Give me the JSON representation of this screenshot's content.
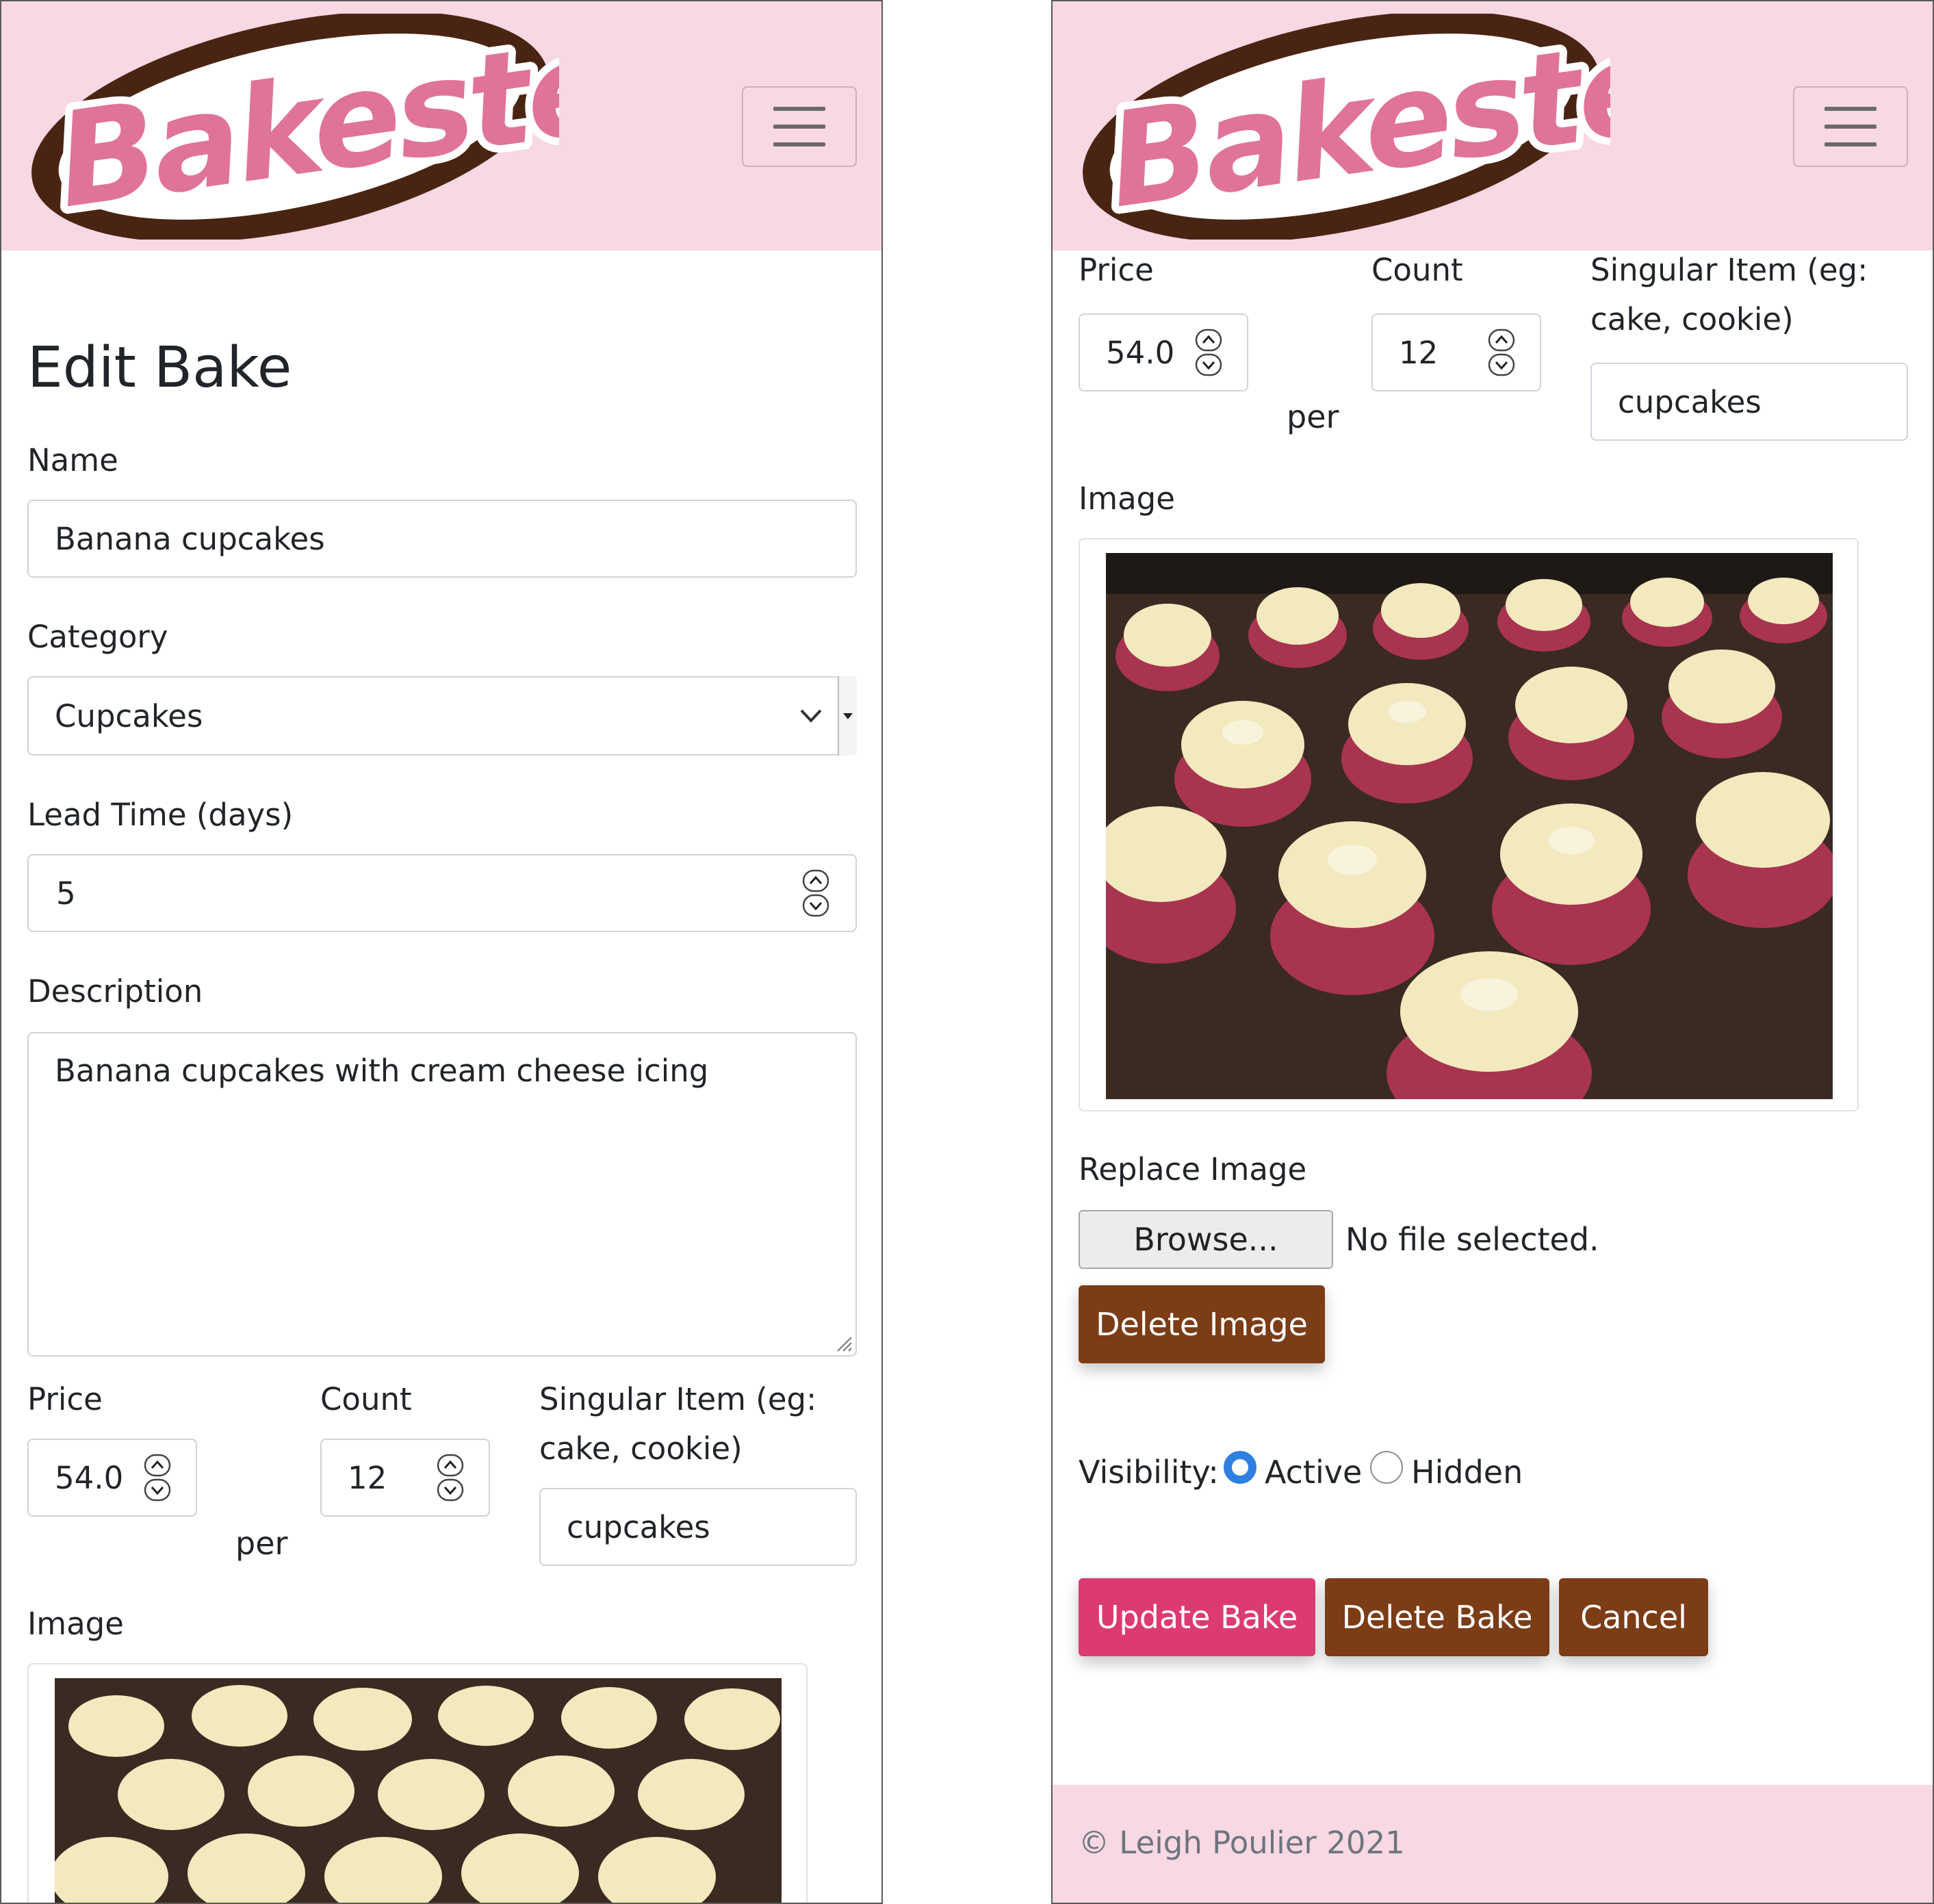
{
  "brand": {
    "logo_text": "Bakester",
    "colors": {
      "navbar_bg": "#f8d8e3",
      "logo_pink": "#e07399",
      "logo_brown": "#4a2413",
      "btn_brown": "#7b3c16",
      "btn_pink": "#dc3a73"
    }
  },
  "icons": {
    "menu": "hamburger-icon",
    "select": "chevron-down-icon",
    "stepper": "spinner-up-down-icon"
  },
  "form": {
    "title": "Edit Bake",
    "name": {
      "label": "Name",
      "value": "Banana cupcakes"
    },
    "category": {
      "label": "Category",
      "value": "Cupcakes"
    },
    "lead_time": {
      "label": "Lead Time (days)",
      "value": "5"
    },
    "description": {
      "label": "Description",
      "value": "Banana cupcakes with cream cheese icing"
    },
    "price": {
      "label": "Price",
      "value": "54.0"
    },
    "per_text": "per",
    "count": {
      "label": "Count",
      "value": "12"
    },
    "singular": {
      "label_line1": "Singular Item (eg:",
      "label_line2": "cake, cookie)",
      "value": "cupcakes"
    },
    "image": {
      "label": "Image"
    },
    "replace_image": {
      "label": "Replace Image",
      "browse_label": "Browse...",
      "status": "No file selected."
    },
    "delete_image_label": "Delete Image",
    "visibility": {
      "label": "Visibility:",
      "options": [
        {
          "label": "Active",
          "selected": true
        },
        {
          "label": "Hidden",
          "selected": false
        }
      ]
    },
    "buttons": {
      "update": "Update Bake",
      "delete": "Delete Bake",
      "cancel": "Cancel"
    }
  },
  "footer": {
    "text": "© Leigh Poulier 2021"
  }
}
